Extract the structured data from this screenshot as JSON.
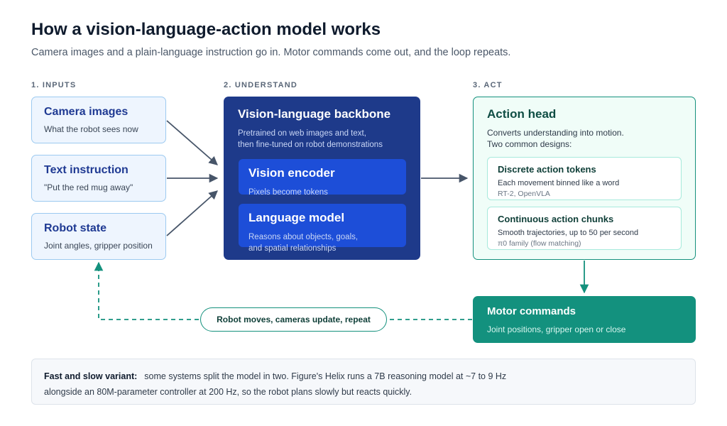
{
  "title": "How a vision-language-action model works",
  "subtitle": "Camera images and a plain-language instruction go in. Motor commands come out, and the loop repeats.",
  "sections": {
    "inputs": "1. INPUTS",
    "understand": "2. UNDERSTAND",
    "act": "3. ACT"
  },
  "inputs": [
    {
      "title": "Camera images",
      "desc": "What the robot sees now"
    },
    {
      "title": "Text instruction",
      "desc": "\"Put the red mug away\""
    },
    {
      "title": "Robot state",
      "desc": "Joint angles, gripper position"
    }
  ],
  "backbone": {
    "title": "Vision-language backbone",
    "desc": "Pretrained on web images and text,\nthen fine-tuned on robot demonstrations",
    "vision": {
      "title": "Vision encoder",
      "desc": "Pixels become tokens"
    },
    "language": {
      "title": "Language model",
      "desc": "Reasons about objects, goals,\nand spatial relationships"
    }
  },
  "action_head": {
    "title": "Action head",
    "desc": "Converts understanding into motion.\nTwo common designs:",
    "discrete": {
      "title": "Discrete action tokens",
      "desc": "Each movement binned like a word",
      "examples": "RT-2, OpenVLA"
    },
    "continuous": {
      "title": "Continuous action chunks",
      "desc": "Smooth trajectories, up to 50 per second",
      "examples": "π0 family (flow matching)"
    }
  },
  "motor": {
    "title": "Motor commands",
    "desc": "Joint positions, gripper open or close"
  },
  "loop_label": "Robot moves, cameras update, repeat",
  "note": {
    "lead": "Fast and slow variant:",
    "line1": "some systems split the model in two. Figure's Helix runs a 7B reasoning model at ~7 to 9 Hz",
    "line2": "alongside an 80M-parameter controller at 200 Hz, so the robot plans slowly but reacts quickly."
  },
  "colors": {
    "input_fill": "#eef5fe",
    "input_border": "#9ccaf0",
    "backbone": "#1e3a8a",
    "backbone_inner": "#1d4ed8",
    "action_border": "#14917d",
    "motor": "#13917e",
    "arrow": "#475569"
  }
}
